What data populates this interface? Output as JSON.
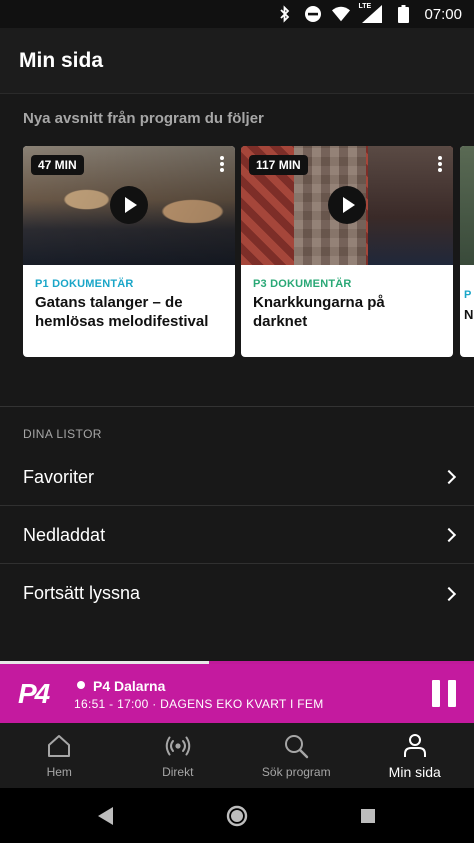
{
  "status_bar": {
    "time": "07:00",
    "icons": [
      "bluetooth-icon",
      "do-not-disturb-icon",
      "wifi-icon",
      "lte-signal-icon",
      "battery-icon"
    ],
    "lte_label": "LTE"
  },
  "header": {
    "title": "Min sida"
  },
  "followed": {
    "title": "Nya avsnitt från program du följer",
    "cards": [
      {
        "duration": "47 MIN",
        "channel": "P1 DOKUMENTÄR",
        "channel_color": "#1aa6c8",
        "title": "Gatans talanger – de hemlösas melodifestival"
      },
      {
        "duration": "117 MIN",
        "channel": "P3 DOKUMENTÄR",
        "channel_color": "#2aa876",
        "title": "Knarkkungarna på darknet"
      },
      {
        "channel": "P",
        "title": "N"
      }
    ]
  },
  "lists": {
    "title": "DINA LISTOR",
    "items": [
      {
        "label": "Favoriter"
      },
      {
        "label": "Nedladdat"
      },
      {
        "label": "Fortsätt lyssna"
      }
    ]
  },
  "player": {
    "logo": "P4",
    "station": "P4 Dalarna",
    "time_info": "16:51 - 17:00  ·  DAGENS EKO  KVART I FEM",
    "progress": 0.44,
    "accent_color": "#c41a9f"
  },
  "bottom_nav": {
    "items": [
      {
        "label": "Hem",
        "icon": "home-icon"
      },
      {
        "label": "Direkt",
        "icon": "live-radio-icon"
      },
      {
        "label": "Sök program",
        "icon": "search-icon"
      },
      {
        "label": "Min sida",
        "icon": "person-icon",
        "active": true
      }
    ]
  },
  "system_nav": {
    "icons": [
      "back-icon",
      "home-circle-icon",
      "recents-icon"
    ]
  }
}
